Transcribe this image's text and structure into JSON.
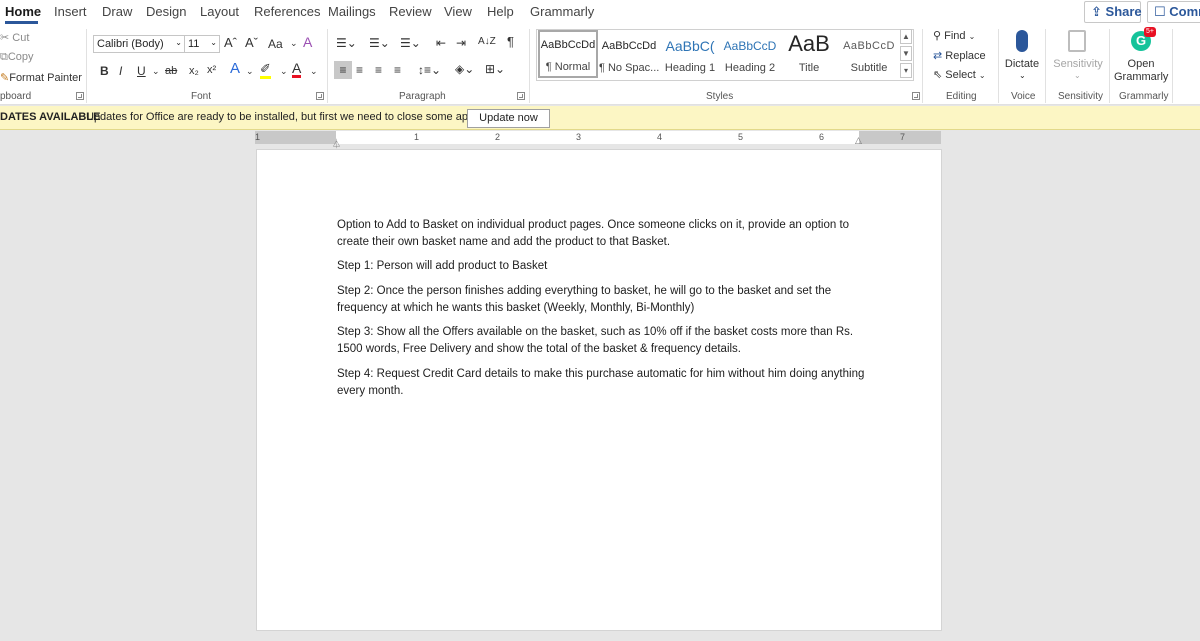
{
  "tabs": [
    "Home",
    "Insert",
    "Draw",
    "Design",
    "Layout",
    "References",
    "Mailings",
    "Review",
    "View",
    "Help",
    "Grammarly"
  ],
  "share_label": "Share",
  "comments_label": "Comm",
  "clipboard": {
    "cut": "Cut",
    "copy": "Copy",
    "format_painter": "Format Painter",
    "group_label": "pboard"
  },
  "font": {
    "family": "Calibri (Body)",
    "size": "11",
    "grow": "Aˆ",
    "shrink": "Aˇ",
    "change_case": "Aa",
    "bold": "B",
    "italic": "I",
    "underline": "U",
    "strikethrough": "ab",
    "subscript": "x₂",
    "superscript": "x²",
    "group_label": "Font"
  },
  "paragraph": {
    "sort": "A↓Z",
    "pilcrow": "¶",
    "group_label": "Paragraph"
  },
  "styles": {
    "items": [
      {
        "sample": "AaBbCcDd",
        "name": "¶ Normal"
      },
      {
        "sample": "AaBbCcDd",
        "name": "¶ No Spac..."
      },
      {
        "sample": "AaBbC(",
        "name": "Heading 1"
      },
      {
        "sample": "AaBbCcD",
        "name": "Heading 2"
      },
      {
        "sample": "AaB",
        "name": "Title"
      },
      {
        "sample": "AaBbCcD",
        "name": "Subtitle"
      }
    ],
    "group_label": "Styles"
  },
  "editing": {
    "find": "Find",
    "replace": "Replace",
    "select": "Select",
    "group_label": "Editing"
  },
  "voice": {
    "dictate": "Dictate",
    "group_label": "Voice"
  },
  "sensitivity": {
    "button": "Sensitivity",
    "group_label": "Sensitivity"
  },
  "grammarly": {
    "open_line1": "Open",
    "open_line2": "Grammarly",
    "badge": "5+",
    "group_label": "Grammarly"
  },
  "update_bar": {
    "title": "DATES AVAILABLE",
    "message": "Updates for Office are ready to be installed, but first we need to close some apps.",
    "button": "Update now"
  },
  "ruler": {
    "numbers": [
      "1",
      "1",
      "2",
      "3",
      "4",
      "5",
      "6",
      "7"
    ]
  },
  "document": {
    "paragraphs": [
      "Option to Add to Basket on individual product pages. Once someone clicks on it, provide an option to create their own basket name and add the product to that Basket.",
      "Step 1: Person will add product to Basket",
      "Step 2: Once the person finishes adding everything to basket, he will go to the basket and set the frequency at which he wants this basket (Weekly, Monthly, Bi-Monthly)",
      "Step 3: Show all the Offers available on the basket, such as 10% off if the basket costs more than Rs. 1500 words, Free Delivery and show the total of the basket & frequency details.",
      "Step 4: Request Credit Card details to make this purchase automatic for him without him doing anything every month."
    ]
  },
  "colors": {
    "accent": "#2b579a",
    "update_bar": "#fcf6c4",
    "grammarly": "#15c39a",
    "font_red": "#e81123",
    "highlight": "#ffff00"
  }
}
